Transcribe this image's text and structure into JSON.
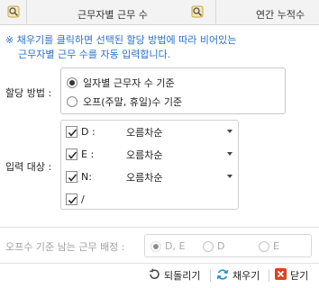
{
  "header": {
    "col_workers": "근무자별 근무 수",
    "col_annual": "연간 누적수"
  },
  "notice": {
    "line1": "※ 채우기를 클릭하면 선택된 할당 방법에 따라 비어있는",
    "line2": "근무자별 근무 수를 자동 입력합니다."
  },
  "allocation": {
    "label": "할당 방법 :",
    "options": [
      {
        "label": "일자별 근무자 수 기준",
        "selected": true
      },
      {
        "label": "오프(주말, 휴일)수 기준",
        "selected": false
      }
    ]
  },
  "targets": {
    "label": "입력 대상 :",
    "rows": [
      {
        "code": "D :",
        "checked": true,
        "sort": "오름차순"
      },
      {
        "code": "E :",
        "checked": true,
        "sort": "오름차순"
      },
      {
        "code": "N:",
        "checked": true,
        "sort": "오름차순"
      },
      {
        "code": "/",
        "checked": true,
        "sort": ""
      }
    ]
  },
  "off_assign": {
    "label": "오프수 기준 남는 근무 배정 :",
    "options": [
      {
        "label": "D, E",
        "selected": true
      },
      {
        "label": "D",
        "selected": false
      },
      {
        "label": "E",
        "selected": false
      }
    ]
  },
  "footer": {
    "undo_label": "되돌리기",
    "fill_label": "채우기",
    "close_label": "닫기"
  },
  "colors": {
    "notice": "#2a6fc9",
    "disabled_text": "#a0a0a0",
    "close_icon": "#e0401f",
    "refresh_icon": "#2a8fd6"
  }
}
